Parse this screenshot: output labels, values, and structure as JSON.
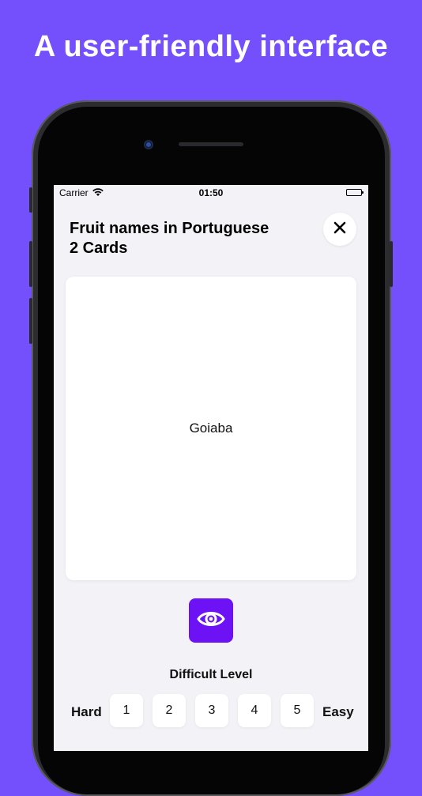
{
  "headline": "A user-friendly interface",
  "status_bar": {
    "carrier": "Carrier",
    "time": "01:50"
  },
  "deck": {
    "title": "Fruit names in Portuguese",
    "count": "2 Cards"
  },
  "card": {
    "word": "Goiaba"
  },
  "difficulty": {
    "label": "Difficult Level",
    "hard": "Hard",
    "easy": "Easy",
    "levels": [
      "1",
      "2",
      "3",
      "4",
      "5"
    ]
  },
  "colors": {
    "background": "#7450fd",
    "accent": "#6d12f5",
    "screen": "#f2f2f7"
  },
  "icons": {
    "close": "close-icon",
    "reveal": "eye-icon",
    "wifi": "wifi-icon",
    "battery": "battery-icon"
  }
}
